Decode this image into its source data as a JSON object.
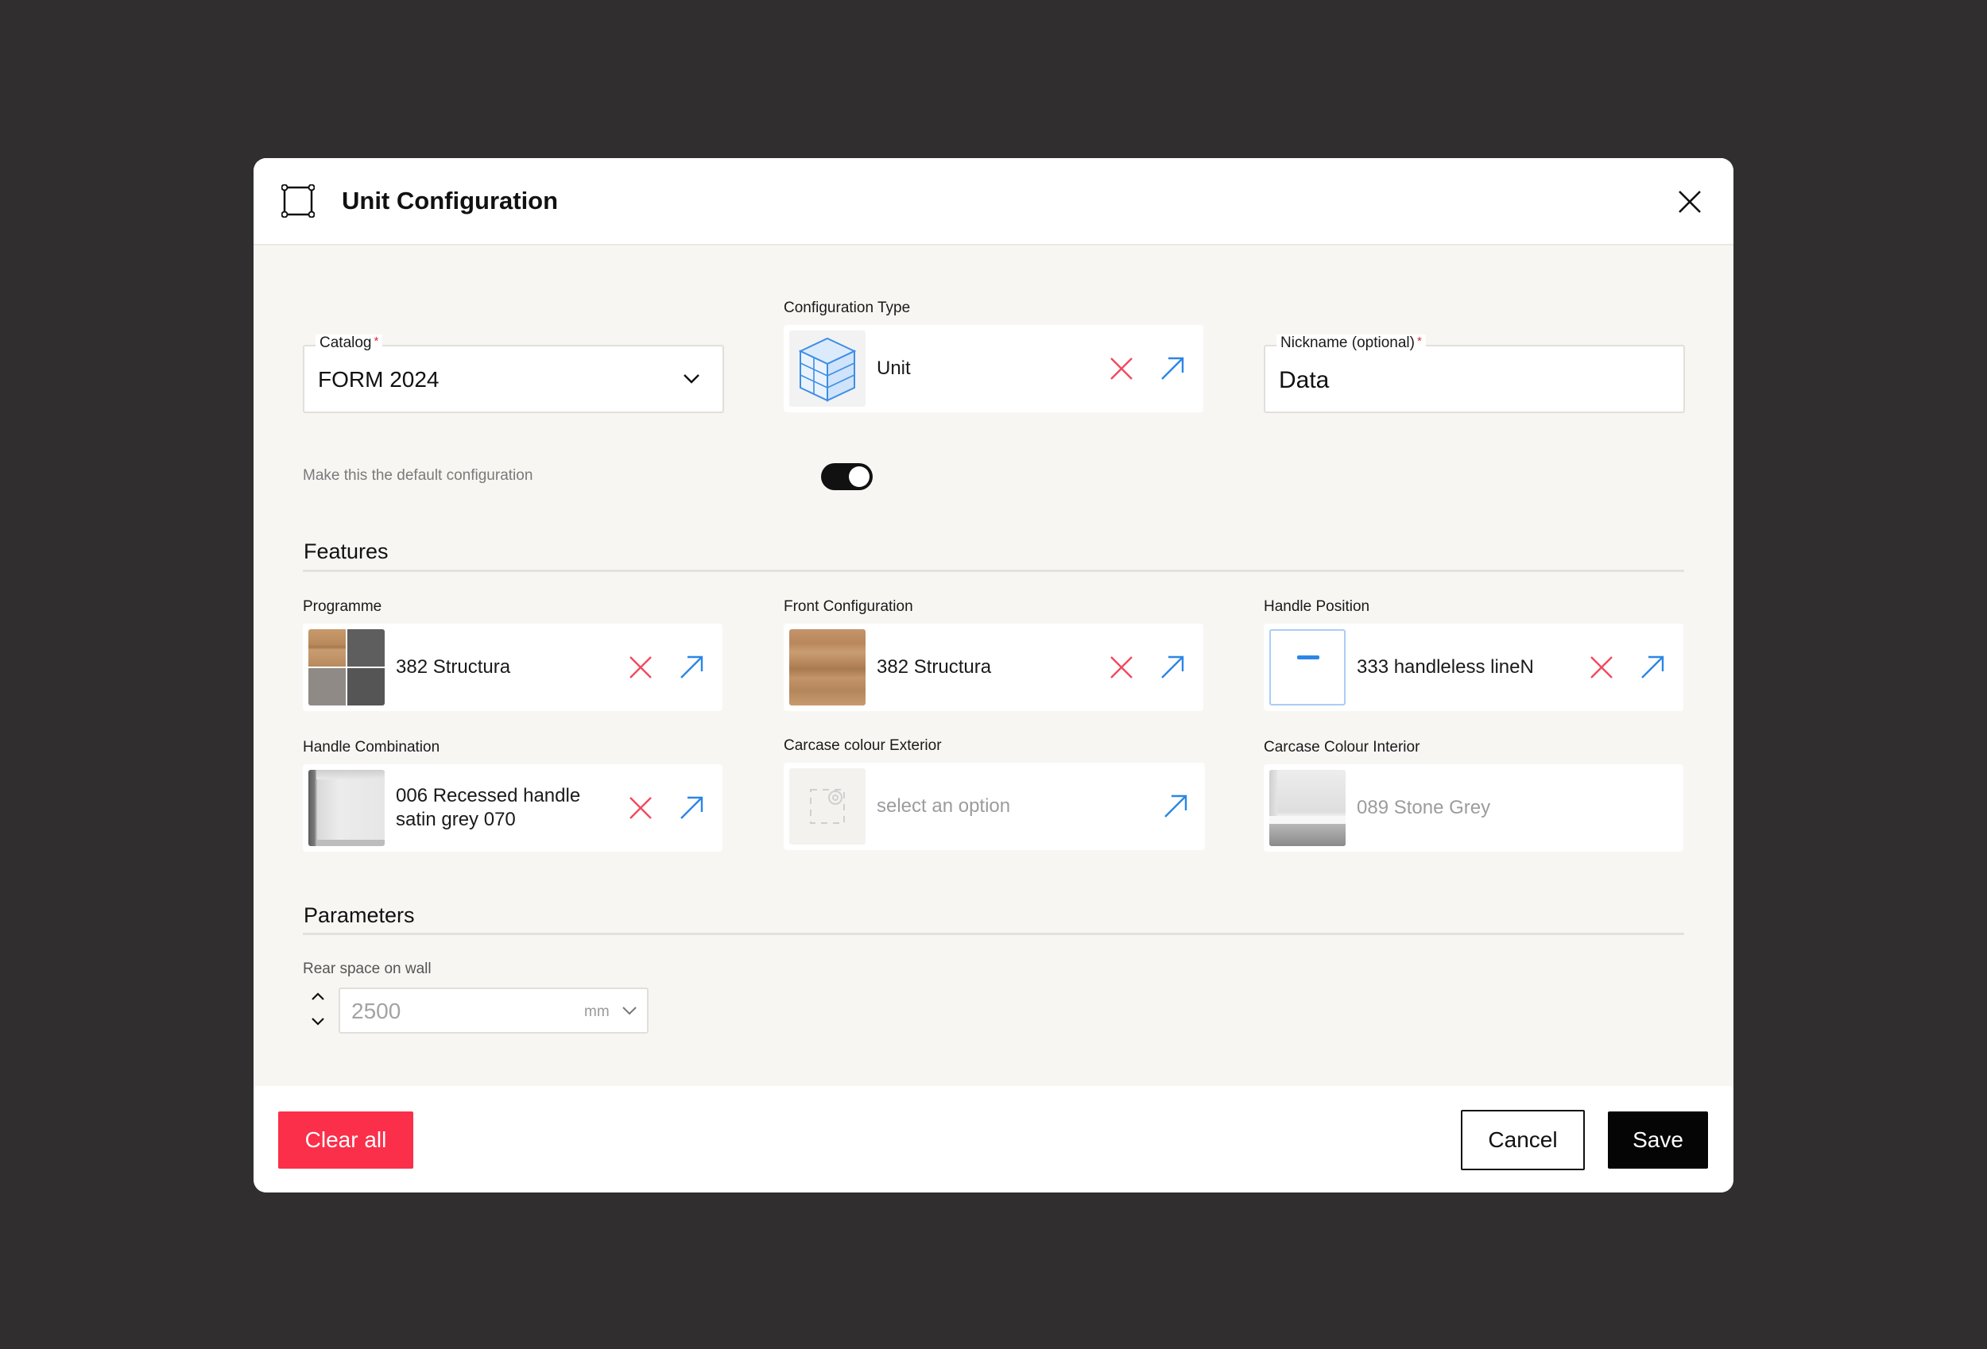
{
  "dialog": {
    "title": "Unit Configuration"
  },
  "catalog": {
    "label": "Catalog",
    "required_mark": "*",
    "value": "FORM 2024"
  },
  "configuration_type": {
    "label": "Configuration Type",
    "value": "Unit"
  },
  "nickname": {
    "label": "Nickname (optional)",
    "required_mark": "*",
    "value": "Data"
  },
  "default_toggle": {
    "label": "Make this the default configuration",
    "on": true
  },
  "features": {
    "title": "Features",
    "items": [
      {
        "label": "Programme",
        "value": "382 Structura",
        "thumbnail": "wood-and-grey-swatch-grid"
      },
      {
        "label": "Front Configuration",
        "value": "382 Structura",
        "thumbnail": "oak-wood-swatch"
      },
      {
        "label": "Handle Position",
        "value": "333 handleless lineN",
        "thumbnail": "handle-position-icon"
      },
      {
        "label": "Handle Combination",
        "value_line1": "006 Recessed handle",
        "value_line2": "satin grey 070",
        "thumbnail": "recessed-handle-photo"
      },
      {
        "label": "Carcase colour Exterior",
        "value": "select an option",
        "thumbnail": "placeholder-gear-icon"
      },
      {
        "label": "Carcase Colour Interior",
        "value": "089 Stone Grey",
        "thumbnail": "stone-grey-interior-photo"
      }
    ]
  },
  "parameters": {
    "title": "Parameters",
    "rear_space": {
      "label": "Rear space on wall",
      "value": "2500",
      "unit": "mm"
    }
  },
  "footer": {
    "clear_label": "Clear all",
    "cancel_label": "Cancel",
    "save_label": "Save"
  },
  "colors": {
    "backdrop": "#302e2f",
    "danger": "#fb2f4a",
    "link_blue": "#2b86e6",
    "primary": "#050505"
  }
}
